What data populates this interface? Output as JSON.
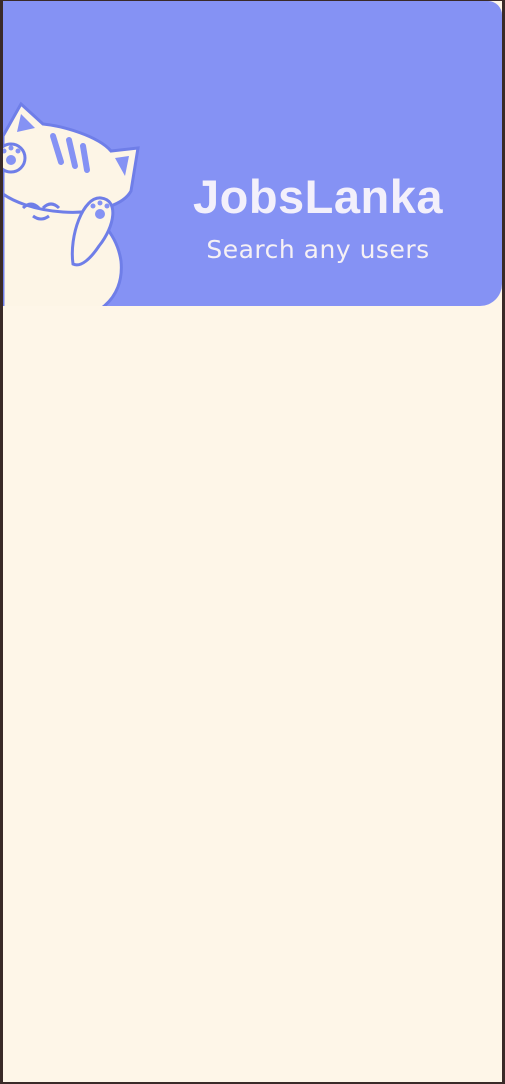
{
  "header": {
    "title": "JobsLanka",
    "subtitle": "Search any users",
    "mascot_icon": "cat-mascot-icon"
  },
  "colors": {
    "header_bg": "#8592f4",
    "page_bg": "#fef6e8",
    "cat_body": "#fdf5e6",
    "cat_outline": "#6f7ee8",
    "title_text": "#f3f0fb"
  }
}
